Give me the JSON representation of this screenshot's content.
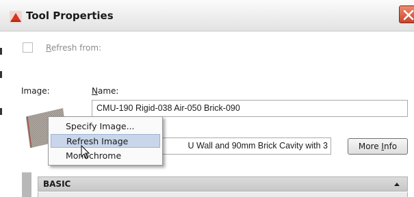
{
  "window": {
    "title": "Tool Properties"
  },
  "refresh": {
    "label_prefix": "",
    "label_underlined": "R",
    "label_rest": "efresh from:"
  },
  "image_section": {
    "label": "Image:",
    "name_label_underlined": "N",
    "name_label_rest": "ame:",
    "name_value": "CMU-190 Rigid-038 Air-050 Brick-090",
    "description_value": "U Wall and 90mm Brick Cavity with 3",
    "more_info_prefix": "More ",
    "more_info_underlined": "I",
    "more_info_rest": "nfo"
  },
  "context_menu": {
    "items": [
      "Specify Image...",
      "Refresh Image",
      "Monochrome"
    ],
    "highlighted_index": 1
  },
  "properties": {
    "section_label": "BASIC"
  },
  "colors": {
    "menu_highlight": "#c9d6ea",
    "close_button": "#c9452a"
  }
}
